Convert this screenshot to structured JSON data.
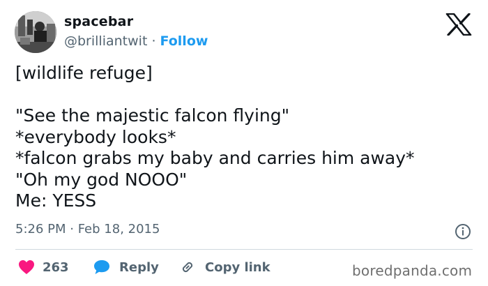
{
  "author": {
    "display_name": "spacebar",
    "handle": "@brilliantwit",
    "separator": "·",
    "follow_label": "Follow"
  },
  "tweet": {
    "lines": [
      "[wildlife refuge]",
      "",
      "\"See the majestic falcon flying\"",
      "*everybody looks*",
      "*falcon grabs my baby and carries him away*",
      "\"Oh my god NOOO\"",
      "Me: YESS"
    ],
    "timestamp": "5:26 PM · Feb 18, 2015"
  },
  "actions": {
    "like_count": "263",
    "reply_label": "Reply",
    "copy_link_label": "Copy link"
  },
  "icons": {
    "logo": "x-logo-icon",
    "info": "info-icon",
    "like": "heart-icon",
    "reply": "speech-bubble-icon",
    "copy": "link-icon"
  },
  "colors": {
    "accent": "#1d9bf0",
    "like": "#f91880",
    "text": "#0f1419",
    "muted": "#536471"
  },
  "watermark": "boredpanda.com"
}
